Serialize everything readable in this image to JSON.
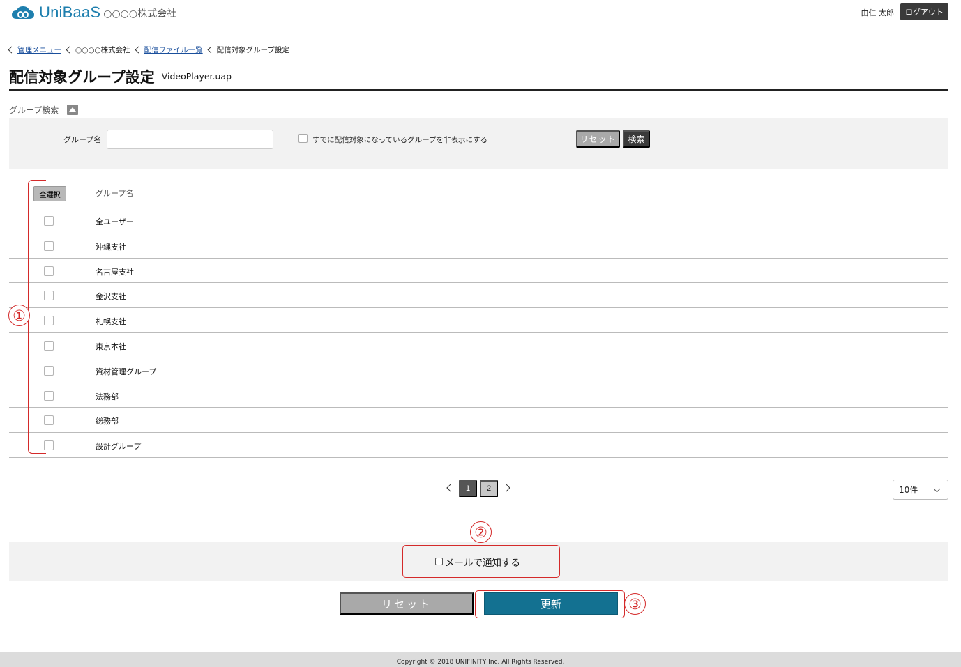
{
  "header": {
    "logo_text": "UniBaaS",
    "company": "○○○○株式会社",
    "user_name": "由仁 太郎",
    "logout_label": "ログアウト"
  },
  "breadcrumb": {
    "items": [
      {
        "label": "管理メニュー",
        "link": true
      },
      {
        "label": "○○○○株式会社",
        "link": false
      },
      {
        "label": "配信ファイル一覧",
        "link": true
      },
      {
        "label": "配信対象グループ設定",
        "link": false
      }
    ]
  },
  "page": {
    "title": "配信対象グループ設定",
    "file_name": "VideoPlayer.uap"
  },
  "search": {
    "toggle_label": "グループ検索",
    "group_name_label": "グループ名",
    "group_name_value": "",
    "hide_assigned_label": "すでに配信対象になっているグループを非表示にする",
    "reset_label": "リセット",
    "search_label": "検索"
  },
  "table": {
    "select_all_label": "全選択",
    "column_header": "グループ名",
    "rows": [
      {
        "name": "全ユーザー",
        "checked": false
      },
      {
        "name": "沖縄支社",
        "checked": false
      },
      {
        "name": "名古屋支社",
        "checked": false
      },
      {
        "name": "金沢支社",
        "checked": false
      },
      {
        "name": "札幌支社",
        "checked": false
      },
      {
        "name": "東京本社",
        "checked": false
      },
      {
        "name": "資材管理グループ",
        "checked": false
      },
      {
        "name": "法務部",
        "checked": false
      },
      {
        "name": "総務部",
        "checked": false
      },
      {
        "name": "設計グループ",
        "checked": false
      }
    ]
  },
  "pagination": {
    "pages": [
      "1",
      "2"
    ],
    "current": "1",
    "per_page": "10件"
  },
  "notify": {
    "label": "メールで通知する",
    "checked": false
  },
  "actions": {
    "reset_label": "リセット",
    "update_label": "更新"
  },
  "annotations": {
    "marker_1": "①",
    "marker_2": "②",
    "marker_3": "③",
    "color": "#d42a2a"
  },
  "footer": {
    "copyright": "Copyright © 2018 UNIFINITY Inc. All Rights Reserved."
  },
  "colors": {
    "brand": "#1e7fae",
    "update_button": "#137191",
    "dark_button": "#3a3a3a",
    "gray_button": "#a9a9a9"
  }
}
